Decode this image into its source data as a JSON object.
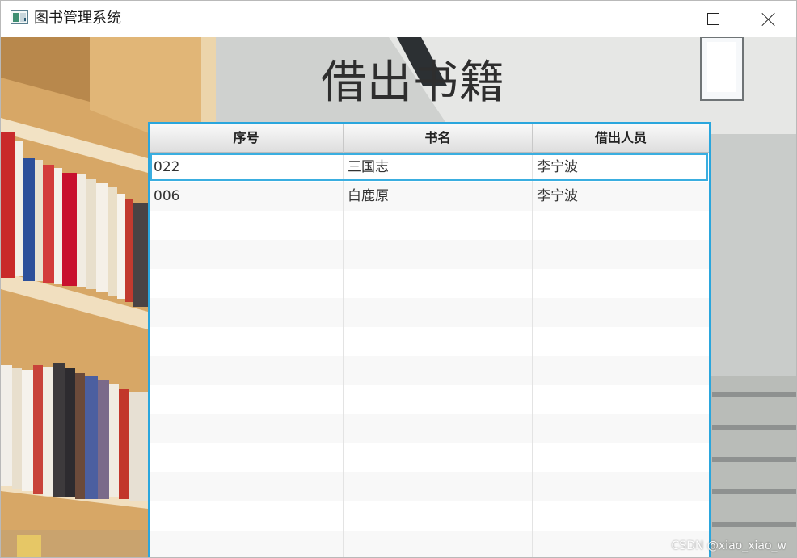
{
  "window": {
    "title": "图书管理系统",
    "icon": "app-window-icon"
  },
  "controls": {
    "minimize_icon": "minimize-icon",
    "maximize_icon": "maximize-icon",
    "close_icon": "close-icon"
  },
  "page": {
    "heading": "借出书籍"
  },
  "table": {
    "columns": [
      "序号",
      "书名",
      "借出人员"
    ],
    "rows": [
      [
        "022",
        "三国志",
        "李宁波"
      ],
      [
        "006",
        "白鹿原",
        "李宁波"
      ]
    ],
    "selected_row": 0
  },
  "watermark": "CSDN @xiao_xiao_w",
  "colors": {
    "accent": "#2aa6dd",
    "heading_text": "#2e2e2e"
  }
}
